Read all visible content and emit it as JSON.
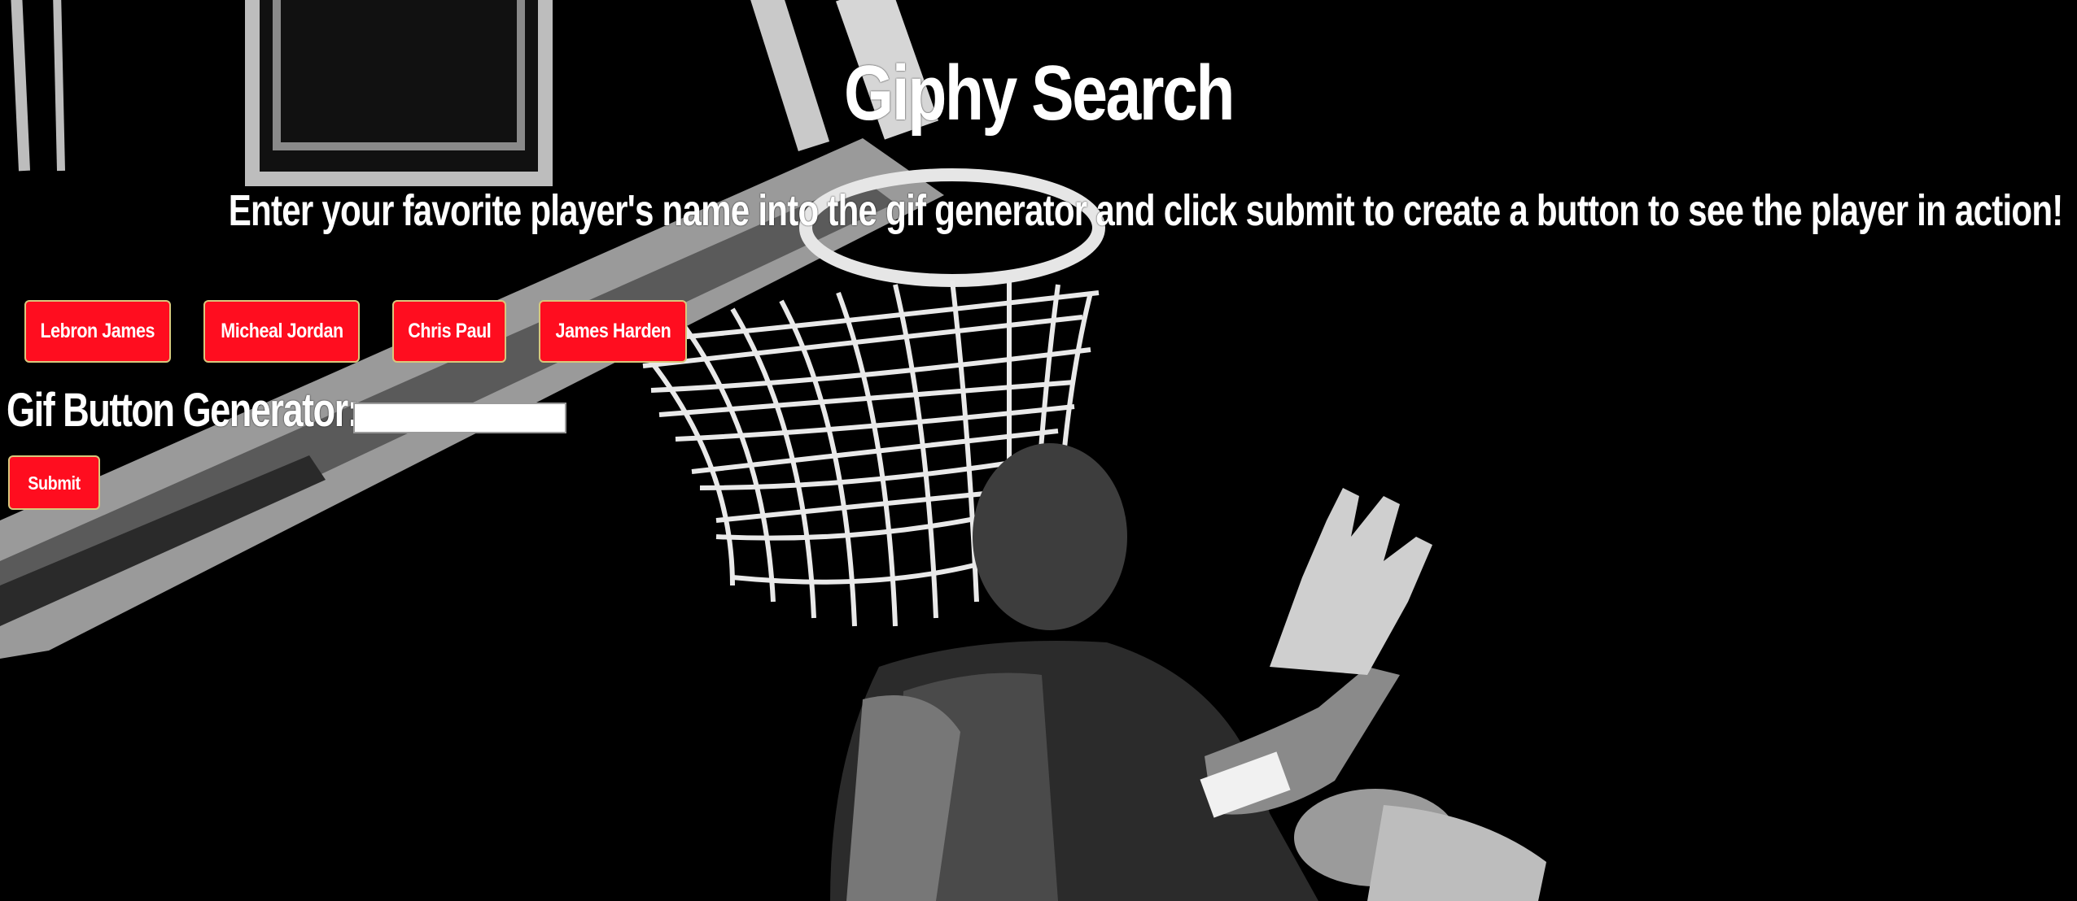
{
  "page": {
    "title": "Giphy Search",
    "subtitle": "Enter your favorite player's name into the gif generator and click submit to create a button to see the player in action!"
  },
  "player_buttons": [
    {
      "label": "Lebron James"
    },
    {
      "label": "Micheal Jordan"
    },
    {
      "label": "Chris Paul"
    },
    {
      "label": "James Harden"
    }
  ],
  "generator": {
    "label": "Gif Button Generator:",
    "input_value": "",
    "submit_label": "Submit"
  },
  "background": {
    "icon": "basketball-dunk-photo",
    "tone": "black-and-white"
  },
  "colors": {
    "button_red": "#ff0d1f",
    "button_border": "#d8c77c",
    "text": "#ffffff",
    "background": "#000000"
  }
}
